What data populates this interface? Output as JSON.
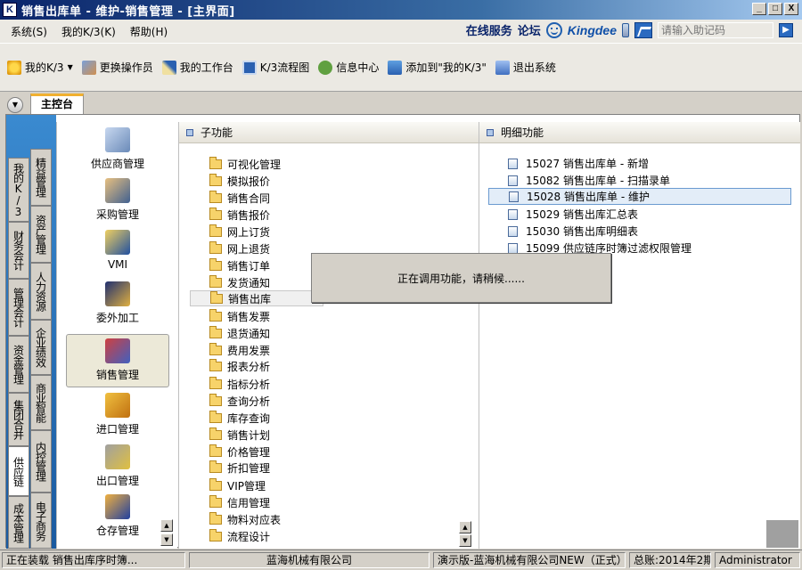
{
  "window": {
    "title": "销售出库单 - 维护-销售管理 - [主界面]",
    "app_icon": "K",
    "btn_min": "_",
    "btn_max": "□",
    "btn_close": "X"
  },
  "menu": {
    "items": [
      "系统(S)",
      "我的K/3(K)",
      "帮助(H)"
    ]
  },
  "services": {
    "online": "在线服务",
    "forum": "论坛",
    "brand": "Kingdee",
    "help_placeholder": "请输入助记码"
  },
  "toolbar": {
    "items": [
      "我的K/3",
      "更换操作员",
      "我的工作台",
      "K/3流程图",
      "信息中心",
      "添加到\"我的K/3\"",
      "退出系统"
    ]
  },
  "tabs": {
    "main": "主控台"
  },
  "vtabs": {
    "col1": [
      "我的K/3",
      "财务会计",
      "管理会计",
      "资金管理",
      "集团合并",
      "供应链",
      "成本管理"
    ],
    "col2": [
      "精益管理",
      "资产管理",
      "人力资源",
      "企业绩效",
      "商业智能",
      "内控管理",
      "电子商务"
    ]
  },
  "modules": [
    "供应商管理",
    "采购管理",
    "VMI",
    "委外加工",
    "销售管理",
    "进口管理",
    "出口管理",
    "仓存管理"
  ],
  "subpanel": {
    "title": "子功能",
    "items": [
      "可视化管理",
      "模拟报价",
      "销售合同",
      "销售报价",
      "网上订货",
      "网上退货",
      "销售订单",
      "发货通知",
      "销售出库",
      "销售发票",
      "退货通知",
      "费用发票",
      "报表分析",
      "指标分析",
      "查询分析",
      "库存查询",
      "销售计划",
      "价格管理",
      "折扣管理",
      "VIP管理",
      "信用管理",
      "物料对应表",
      "流程设计"
    ]
  },
  "detailpanel": {
    "title": "明细功能",
    "items": [
      {
        "code": "15027",
        "label": "销售出库单 - 新增"
      },
      {
        "code": "15082",
        "label": "销售出库单 - 扫描录单"
      },
      {
        "code": "15028",
        "label": "销售出库单 - 维护"
      },
      {
        "code": "15029",
        "label": "销售出库汇总表"
      },
      {
        "code": "15030",
        "label": "销售出库明细表"
      },
      {
        "code": "15099",
        "label": "供应链序时簿过滤权限管理"
      }
    ]
  },
  "loading": {
    "text": "正在调用功能，请稍候......"
  },
  "status": {
    "loading": "正在装载 销售出库序时簿...",
    "company": "蓝海机械有限公司",
    "account": "演示版-蓝海机械有限公司NEW（正式）",
    "period": "总账:2014年2期",
    "user": "Administrator"
  }
}
